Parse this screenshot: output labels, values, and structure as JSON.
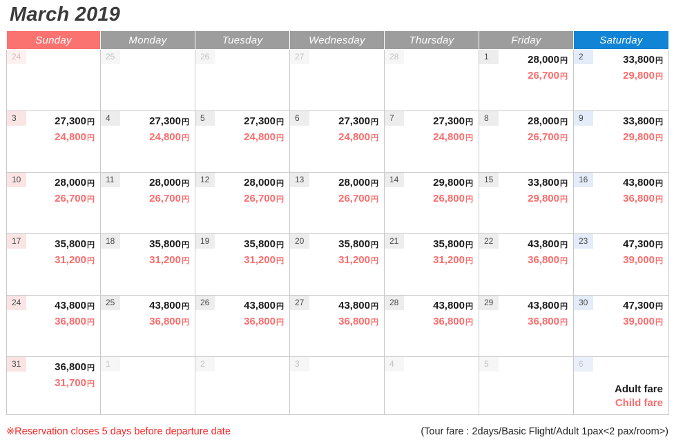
{
  "header": {
    "title": "March 2019"
  },
  "weekdays": [
    {
      "label": "Sunday",
      "kind": "sun"
    },
    {
      "label": "Monday",
      "kind": "wd"
    },
    {
      "label": "Tuesday",
      "kind": "wd"
    },
    {
      "label": "Wednesday",
      "kind": "wd"
    },
    {
      "label": "Thursday",
      "kind": "wd"
    },
    {
      "label": "Friday",
      "kind": "wd"
    },
    {
      "label": "Saturday",
      "kind": "sat"
    }
  ],
  "currency_symbol": "円",
  "colors": {
    "sunday_header": "#fb7370",
    "weekday_header": "#9d9d9d",
    "saturday_header": "#1184d6",
    "sunday_column": "#fdeeee",
    "saturday_column": "#edf3fb",
    "adult_fare_text": "#1c1c1c",
    "child_fare_text": "#fb6d6d",
    "notice_text": "#fb2626"
  },
  "legend": {
    "adult_label": "Adult fare",
    "child_label": "Child fare"
  },
  "footer": {
    "notice": "※Reservation closes 5 days before departure date",
    "tour_note": "(Tour fare : 2days/Basic Flight/Adult 1pax<2 pax/room>)"
  },
  "weeks": [
    [
      {
        "day": "24",
        "muted": true,
        "adult": "",
        "child": ""
      },
      {
        "day": "25",
        "muted": true,
        "adult": "",
        "child": ""
      },
      {
        "day": "26",
        "muted": true,
        "adult": "",
        "child": ""
      },
      {
        "day": "27",
        "muted": true,
        "adult": "",
        "child": ""
      },
      {
        "day": "28",
        "muted": true,
        "adult": "",
        "child": ""
      },
      {
        "day": "1",
        "muted": false,
        "adult": "28,000",
        "child": "26,700"
      },
      {
        "day": "2",
        "muted": false,
        "adult": "33,800",
        "child": "29,800"
      }
    ],
    [
      {
        "day": "3",
        "muted": false,
        "adult": "27,300",
        "child": "24,800"
      },
      {
        "day": "4",
        "muted": false,
        "adult": "27,300",
        "child": "24,800"
      },
      {
        "day": "5",
        "muted": false,
        "adult": "27,300",
        "child": "24,800"
      },
      {
        "day": "6",
        "muted": false,
        "adult": "27,300",
        "child": "24,800"
      },
      {
        "day": "7",
        "muted": false,
        "adult": "27,300",
        "child": "24,800"
      },
      {
        "day": "8",
        "muted": false,
        "adult": "28,000",
        "child": "26,700"
      },
      {
        "day": "9",
        "muted": false,
        "adult": "33,800",
        "child": "29,800"
      }
    ],
    [
      {
        "day": "10",
        "muted": false,
        "adult": "28,000",
        "child": "26,700"
      },
      {
        "day": "11",
        "muted": false,
        "adult": "28,000",
        "child": "26,700"
      },
      {
        "day": "12",
        "muted": false,
        "adult": "28,000",
        "child": "26,700"
      },
      {
        "day": "13",
        "muted": false,
        "adult": "28,000",
        "child": "26,700"
      },
      {
        "day": "14",
        "muted": false,
        "adult": "29,800",
        "child": "26,800"
      },
      {
        "day": "15",
        "muted": false,
        "adult": "33,800",
        "child": "29,800"
      },
      {
        "day": "16",
        "muted": false,
        "adult": "43,800",
        "child": "36,800"
      }
    ],
    [
      {
        "day": "17",
        "muted": false,
        "adult": "35,800",
        "child": "31,200"
      },
      {
        "day": "18",
        "muted": false,
        "adult": "35,800",
        "child": "31,200"
      },
      {
        "day": "19",
        "muted": false,
        "adult": "35,800",
        "child": "31,200"
      },
      {
        "day": "20",
        "muted": false,
        "adult": "35,800",
        "child": "31,200"
      },
      {
        "day": "21",
        "muted": false,
        "adult": "35,800",
        "child": "31,200"
      },
      {
        "day": "22",
        "muted": false,
        "adult": "43,800",
        "child": "36,800"
      },
      {
        "day": "23",
        "muted": false,
        "adult": "47,300",
        "child": "39,000"
      }
    ],
    [
      {
        "day": "24",
        "muted": false,
        "adult": "43,800",
        "child": "36,800"
      },
      {
        "day": "25",
        "muted": false,
        "adult": "43,800",
        "child": "36,800"
      },
      {
        "day": "26",
        "muted": false,
        "adult": "43,800",
        "child": "36,800"
      },
      {
        "day": "27",
        "muted": false,
        "adult": "43,800",
        "child": "36,800"
      },
      {
        "day": "28",
        "muted": false,
        "adult": "43,800",
        "child": "36,800"
      },
      {
        "day": "29",
        "muted": false,
        "adult": "43,800",
        "child": "36,800"
      },
      {
        "day": "30",
        "muted": false,
        "adult": "47,300",
        "child": "39,000"
      }
    ],
    [
      {
        "day": "31",
        "muted": false,
        "adult": "36,800",
        "child": "31,700"
      },
      {
        "day": "1",
        "muted": true,
        "adult": "",
        "child": ""
      },
      {
        "day": "2",
        "muted": true,
        "adult": "",
        "child": ""
      },
      {
        "day": "3",
        "muted": true,
        "adult": "",
        "child": ""
      },
      {
        "day": "4",
        "muted": true,
        "adult": "",
        "child": ""
      },
      {
        "day": "5",
        "muted": true,
        "adult": "",
        "child": ""
      },
      {
        "day": "6",
        "muted": true,
        "adult": "",
        "child": "",
        "legend": true
      }
    ]
  ]
}
